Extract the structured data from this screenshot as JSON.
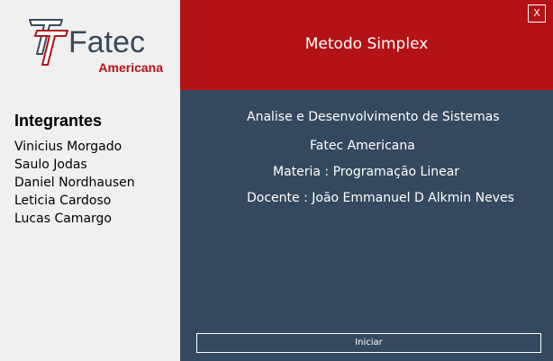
{
  "window": {
    "close_label": "X"
  },
  "logo": {
    "text": "Fatec",
    "subtext": "Americana",
    "icon": "fatec-logo-icon"
  },
  "sidebar": {
    "title": "Integrantes",
    "members": [
      "Vinicius Morgado",
      "Saulo Jodas",
      "Daniel Nordhausen",
      "Leticia Cardoso",
      "Lucas Camargo"
    ]
  },
  "header": {
    "title": "Metodo Simplex"
  },
  "main": {
    "course": "Analise e Desenvolvimento de Sistemas",
    "college": "Fatec Americana",
    "subject": "Materia : Programação Linear",
    "teacher": "Docente : João Emmanuel D Alkmin Neves",
    "start_label": "Iniciar"
  },
  "colors": {
    "header_red": "#b31217",
    "content_slate": "#34495e",
    "sidebar_gray": "#f0f0f0",
    "logo_dark": "#3a4a5a"
  }
}
